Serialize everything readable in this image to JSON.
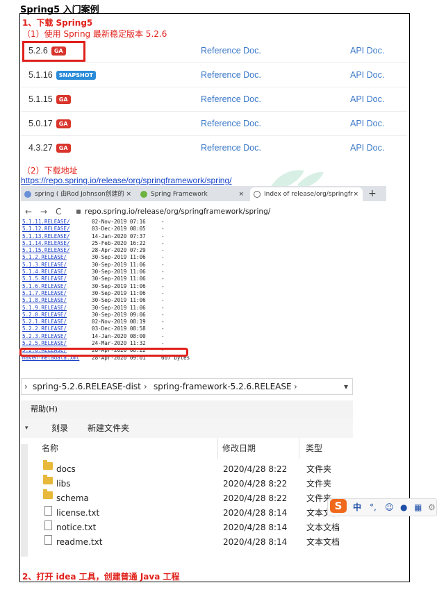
{
  "title": "Spring5 入门案例",
  "step1": "1、下载 Spring5",
  "sub1": "（1）使用 Spring 最新稳定版本 5.2.6",
  "versions": [
    {
      "ver": "5.2.6",
      "badge": "GA",
      "ref": "Reference Doc.",
      "api": "API Doc."
    },
    {
      "ver": "5.1.16",
      "badge": "SNAPSHOT",
      "ref": "Reference Doc.",
      "api": "API Doc."
    },
    {
      "ver": "5.1.15",
      "badge": "GA",
      "ref": "Reference Doc.",
      "api": "API Doc."
    },
    {
      "ver": "5.0.17",
      "badge": "GA",
      "ref": "Reference Doc.",
      "api": "API Doc."
    },
    {
      "ver": "4.3.27",
      "badge": "GA",
      "ref": "Reference Doc.",
      "api": "API Doc."
    }
  ],
  "sub2": "（2）下载地址",
  "url": "https://repo.spring.io/release/org/springframework/spring/",
  "browser": {
    "tabs": [
      "spring ( 由Rod Johnson创建的",
      "Spring Framework",
      "Index of release/org/springfr"
    ],
    "tab_close": "×",
    "new_tab": "+",
    "back": "←",
    "forward": "→",
    "reload": "C",
    "address": "repo.spring.io/release/org/springframework/spring/"
  },
  "listing": [
    {
      "name": "5.1.11.RELEASE/",
      "date": "02-Nov-2019 07:16",
      "size": "-"
    },
    {
      "name": "5.1.12.RELEASE/",
      "date": "03-Dec-2019 08:05",
      "size": "-"
    },
    {
      "name": "5.1.13.RELEASE/",
      "date": "14-Jan-2020 07:37",
      "size": "-"
    },
    {
      "name": "5.1.14.RELEASE/",
      "date": "25-Feb-2020 16:22",
      "size": "-"
    },
    {
      "name": "5.1.15.RELEASE/",
      "date": "28-Apr-2020 07:29",
      "size": "-"
    },
    {
      "name": "5.1.2.RELEASE/",
      "date": "30-Sep-2019 11:06",
      "size": "-"
    },
    {
      "name": "5.1.3.RELEASE/",
      "date": "30-Sep-2019 11:06",
      "size": "-"
    },
    {
      "name": "5.1.4.RELEASE/",
      "date": "30-Sep-2019 11:06",
      "size": "-"
    },
    {
      "name": "5.1.5.RELEASE/",
      "date": "30-Sep-2019 11:06",
      "size": "-"
    },
    {
      "name": "5.1.6.RELEASE/",
      "date": "30-Sep-2019 11:06",
      "size": "-"
    },
    {
      "name": "5.1.7.RELEASE/",
      "date": "30-Sep-2019 11:06",
      "size": "-"
    },
    {
      "name": "5.1.8.RELEASE/",
      "date": "30-Sep-2019 11:06",
      "size": "-"
    },
    {
      "name": "5.1.9.RELEASE/",
      "date": "30-Sep-2019 11:06",
      "size": "-"
    },
    {
      "name": "5.2.0.RELEASE/",
      "date": "30-Sep-2019 09:06",
      "size": "-"
    },
    {
      "name": "5.2.1.RELEASE/",
      "date": "02-Nov-2019 08:19",
      "size": "-"
    },
    {
      "name": "5.2.2.RELEASE/",
      "date": "03-Dec-2019 08:58",
      "size": "-"
    },
    {
      "name": "5.2.3.RELEASE/",
      "date": "14-Jan-2020 08:00",
      "size": "-"
    },
    {
      "name": "5.2.5.RELEASE/",
      "date": "24-Mar-2020 11:32",
      "size": "-"
    },
    {
      "name": "5.2.6.RELEASE/",
      "date": "28-Apr-2020 08:22",
      "size": "-"
    },
    {
      "name": "maven-metadata.xml",
      "date": "28-Apr-2020 09:01",
      "size": "607 bytes"
    }
  ],
  "explorer": {
    "crumb1": "spring-5.2.6.RELEASE-dist",
    "crumb2": "spring-framework-5.2.6.RELEASE",
    "sep": "›",
    "dropdown": "▾",
    "menu_help": "帮助(H)",
    "burn": "刻录",
    "new_folder": "新建文件夹",
    "col_name": "名称",
    "col_date": "修改日期",
    "col_type": "类型",
    "files": [
      {
        "name": "docs",
        "date": "2020/4/28 8:22",
        "type": "文件夹",
        "kind": "folder"
      },
      {
        "name": "libs",
        "date": "2020/4/28 8:22",
        "type": "文件夹",
        "kind": "folder"
      },
      {
        "name": "schema",
        "date": "2020/4/28 8:22",
        "type": "文件夹",
        "kind": "folder"
      },
      {
        "name": "license.txt",
        "date": "2020/4/28 8:14",
        "type": "文本文档",
        "kind": "file"
      },
      {
        "name": "notice.txt",
        "date": "2020/4/28 8:14",
        "type": "文本文档",
        "kind": "file"
      },
      {
        "name": "readme.txt",
        "date": "2020/4/28 8:14",
        "type": "文本文档",
        "kind": "file"
      }
    ]
  },
  "ime": {
    "logo": "S",
    "lang": "中",
    "punct": "°,",
    "emoji": "☺",
    "mic": "●",
    "kbd": "▦",
    "more": "⚙"
  },
  "step2": "2、打开 idea 工具，创建普通 Java 工程",
  "colors": {
    "red": "#e0201a",
    "link": "#3a78c8",
    "ga": "#d9342b",
    "snapshot": "#2b8bd8"
  }
}
